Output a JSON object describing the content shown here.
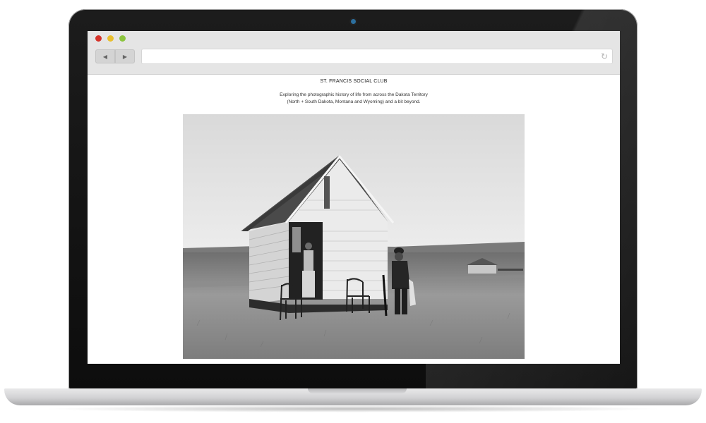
{
  "browser": {
    "back_icon": "◀",
    "forward_icon": "▶",
    "reload_icon": "↻",
    "url": ""
  },
  "page": {
    "title": "ST. FRANCIS SOCIAL CLUB",
    "tagline_line1": "Exploring the photographic history of life from across the Dakota Territory",
    "tagline_line2": "(North + South Dakota, Montana and Wyoming) and a bit beyond."
  },
  "colors": {
    "close": "#d6332a",
    "minimize": "#e9bf2e",
    "maximize": "#8cc53f",
    "camera": "#2c6f9e"
  }
}
